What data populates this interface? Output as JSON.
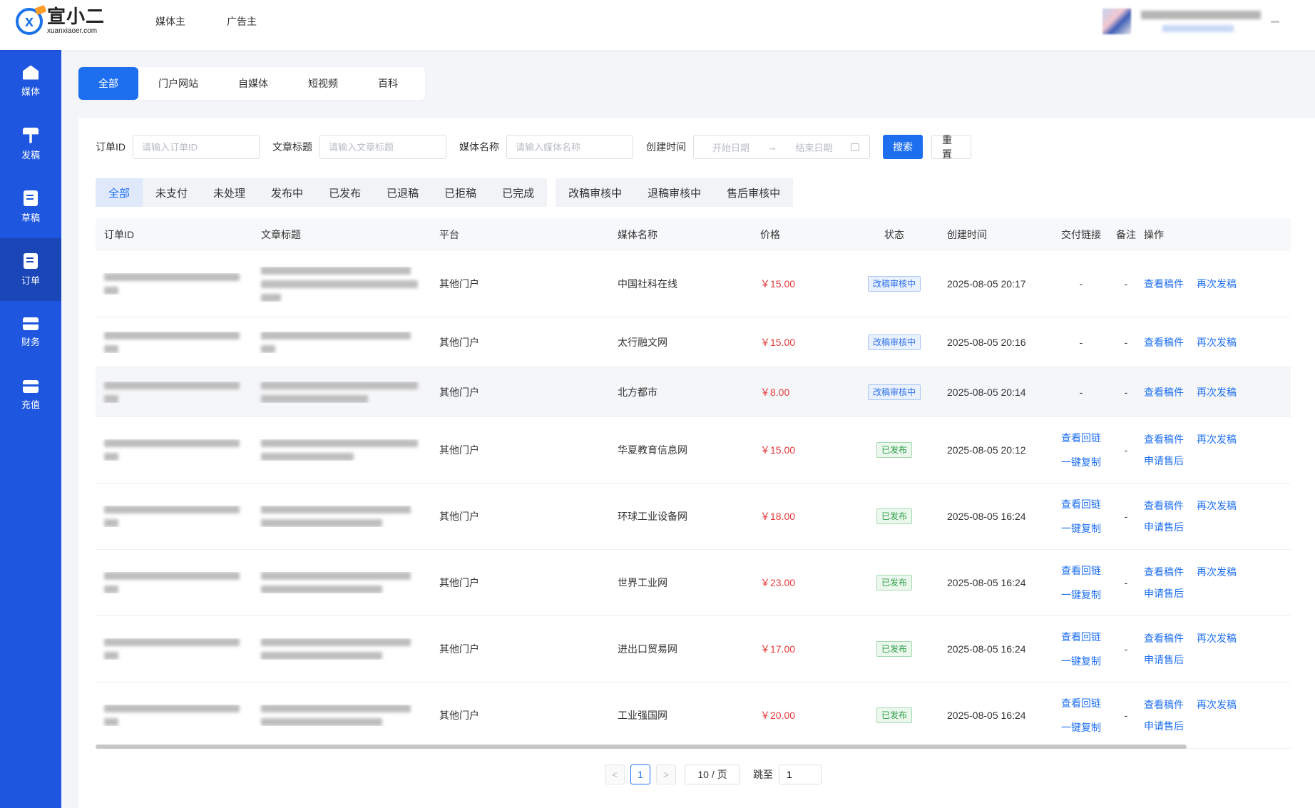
{
  "brand": {
    "name_cn": "宣小二",
    "name_en": "xuanxiaoer.com",
    "mark": "x"
  },
  "top_nav": [
    "媒体主",
    "广告主"
  ],
  "sidebar": [
    {
      "label": "媒体",
      "icon": "home-icon"
    },
    {
      "label": "发稿",
      "icon": "billboard-icon"
    },
    {
      "label": "草稿",
      "icon": "edit-note-icon"
    },
    {
      "label": "订单",
      "icon": "order-icon",
      "active": true
    },
    {
      "label": "财务",
      "icon": "wallet-icon"
    },
    {
      "label": "充值",
      "icon": "card-icon"
    }
  ],
  "type_tabs": [
    "全部",
    "门户网站",
    "自媒体",
    "短视频",
    "百科"
  ],
  "filters": {
    "order_id": {
      "label": "订单ID",
      "placeholder": "请输入订单ID"
    },
    "title": {
      "label": "文章标题",
      "placeholder": "请输入文章标题"
    },
    "media": {
      "label": "媒体名称",
      "placeholder": "请输入媒体名称"
    },
    "created": {
      "label": "创建时间",
      "start": "开始日期",
      "arrow": "→",
      "end": "结束日期"
    },
    "search_btn": "搜索",
    "reset_btn": "重置"
  },
  "status_tabs": {
    "group1": [
      "全部",
      "未支付",
      "未处理",
      "发布中",
      "已发布",
      "已退稿",
      "已拒稿",
      "已完成"
    ],
    "group2": [
      "改稿审核中",
      "退稿审核中",
      "售后审核中"
    ]
  },
  "table": {
    "headers": [
      "订单ID",
      "文章标题",
      "平台",
      "媒体名称",
      "价格",
      "状态",
      "创建时间",
      "交付链接",
      "备注",
      "操作"
    ],
    "rows": [
      {
        "platform": "其他门户",
        "media": "中国社科在线",
        "price": "￥15.00",
        "status": "改稿审核中",
        "status_type": "rev",
        "time": "2025-08-05 20:17",
        "link": "-",
        "note": "-",
        "ops": [
          "查看稿件",
          "再次发稿"
        ]
      },
      {
        "platform": "其他门户",
        "media": "太行融文网",
        "price": "￥15.00",
        "status": "改稿审核中",
        "status_type": "rev",
        "time": "2025-08-05 20:16",
        "link": "-",
        "note": "-",
        "ops": [
          "查看稿件",
          "再次发稿"
        ]
      },
      {
        "platform": "其他门户",
        "media": "北方都市",
        "price": "￥8.00",
        "status": "改稿审核中",
        "status_type": "rev",
        "time": "2025-08-05 20:14",
        "link": "-",
        "note": "-",
        "ops": [
          "查看稿件",
          "再次发稿"
        ]
      },
      {
        "platform": "其他门户",
        "media": "华夏教育信息网",
        "price": "￥15.00",
        "status": "已发布",
        "status_type": "pub",
        "time": "2025-08-05 20:12",
        "links": [
          "查看回链",
          "一键复制"
        ],
        "note": "-",
        "ops": [
          "查看稿件",
          "再次发稿"
        ],
        "ops2": "申请售后"
      },
      {
        "platform": "其他门户",
        "media": "环球工业设备网",
        "price": "￥18.00",
        "status": "已发布",
        "status_type": "pub",
        "time": "2025-08-05 16:24",
        "links": [
          "查看回链",
          "一键复制"
        ],
        "note": "-",
        "ops": [
          "查看稿件",
          "再次发稿"
        ],
        "ops2": "申请售后"
      },
      {
        "platform": "其他门户",
        "media": "世界工业网",
        "price": "￥23.00",
        "status": "已发布",
        "status_type": "pub",
        "time": "2025-08-05 16:24",
        "links": [
          "查看回链",
          "一键复制"
        ],
        "note": "-",
        "ops": [
          "查看稿件",
          "再次发稿"
        ],
        "ops2": "申请售后"
      },
      {
        "platform": "其他门户",
        "media": "进出口贸易网",
        "price": "￥17.00",
        "status": "已发布",
        "status_type": "pub",
        "time": "2025-08-05 16:24",
        "links": [
          "查看回链",
          "一键复制"
        ],
        "note": "-",
        "ops": [
          "查看稿件",
          "再次发稿"
        ],
        "ops2": "申请售后"
      },
      {
        "platform": "其他门户",
        "media": "工业强国网",
        "price": "￥20.00",
        "status": "已发布",
        "status_type": "pub",
        "time": "2025-08-05 16:24",
        "links": [
          "查看回链",
          "一键复制"
        ],
        "note": "-",
        "ops": [
          "查看稿件",
          "再次发稿"
        ],
        "ops2": "申请售后"
      }
    ]
  },
  "pagination": {
    "prev": "<",
    "current": "1",
    "next": ">",
    "page_size": "10 / 页",
    "jump_label": "跳至",
    "jump_value": "1"
  }
}
